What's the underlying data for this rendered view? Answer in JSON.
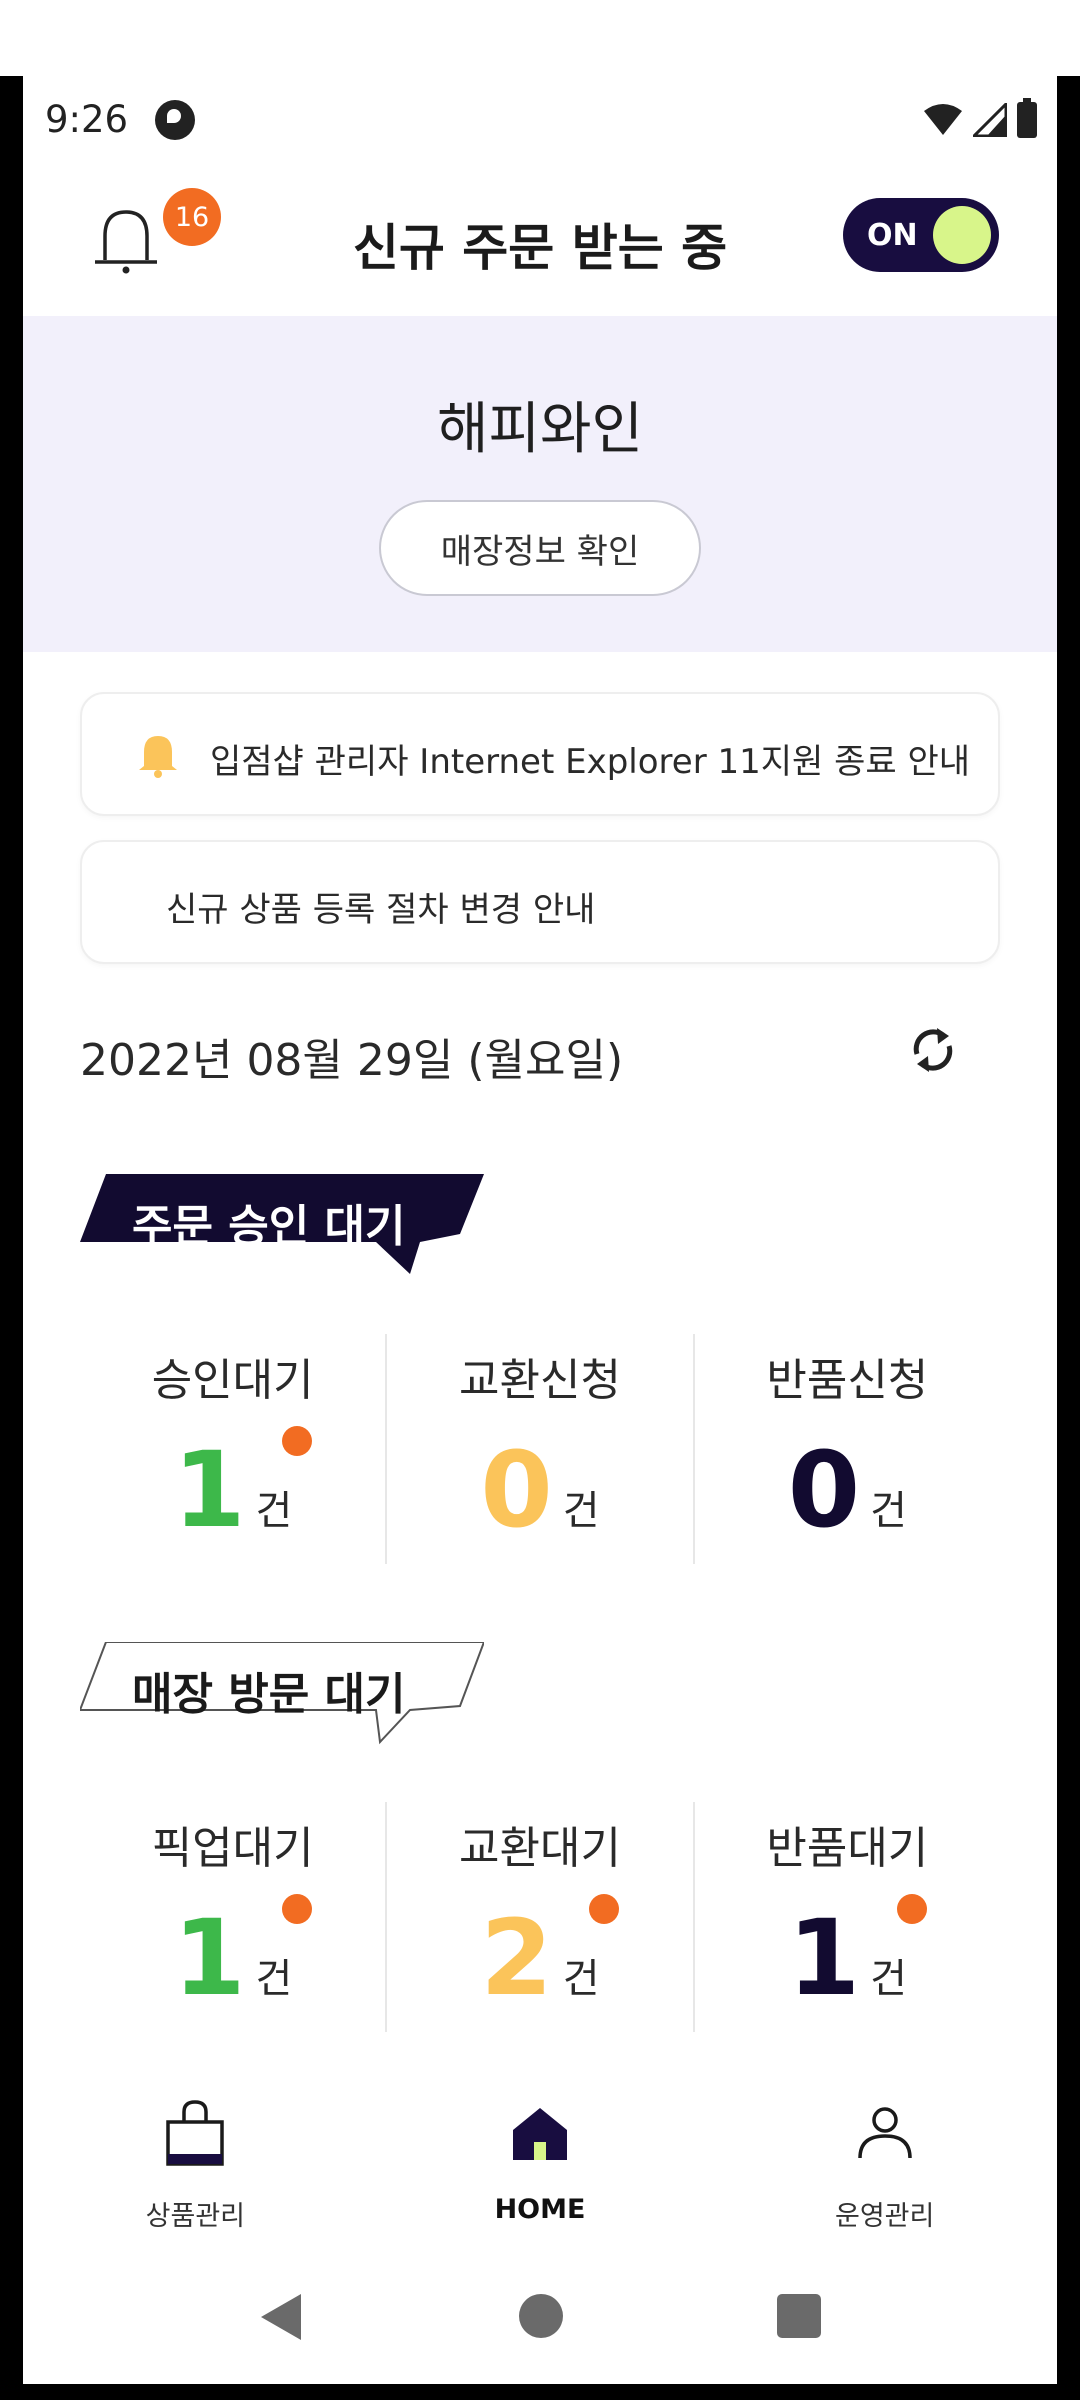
{
  "status_bar": {
    "time": "9:26"
  },
  "header": {
    "title": "신규 주문 받는 중",
    "notification_count": "16",
    "toggle_label": "ON"
  },
  "store": {
    "name": "해피와인",
    "info_button": "매장정보 확인"
  },
  "notices": [
    {
      "text": "입점샵 관리자 Internet Explorer 11지원 종료 안내"
    },
    {
      "text": "신규 상품 등록 절차 변경 안내"
    }
  ],
  "date": "2022년 08월 29일 (월요일)",
  "sections": [
    {
      "title": "주문 승인 대기",
      "stats": [
        {
          "label": "승인대기",
          "value": "1",
          "unit": "건",
          "color": "#3db84a",
          "dot": true
        },
        {
          "label": "교환신청",
          "value": "0",
          "unit": "건",
          "color": "#fbc45a",
          "dot": false
        },
        {
          "label": "반품신청",
          "value": "0",
          "unit": "건",
          "color": "#120b30",
          "dot": false
        }
      ]
    },
    {
      "title": "매장 방문 대기",
      "stats": [
        {
          "label": "픽업대기",
          "value": "1",
          "unit": "건",
          "color": "#3db84a",
          "dot": true
        },
        {
          "label": "교환대기",
          "value": "2",
          "unit": "건",
          "color": "#fbc45a",
          "dot": true
        },
        {
          "label": "반품대기",
          "value": "1",
          "unit": "건",
          "color": "#120b30",
          "dot": true
        }
      ]
    }
  ],
  "bottom_nav": [
    {
      "label": "상품관리",
      "icon": "shopping-bag-icon"
    },
    {
      "label": "HOME",
      "icon": "home-icon",
      "active": true
    },
    {
      "label": "운영관리",
      "icon": "user-icon"
    }
  ],
  "colors": {
    "brand_dark": "#180d40",
    "accent_orange": "#f26c22",
    "band_bg": "#f2f0fb"
  }
}
